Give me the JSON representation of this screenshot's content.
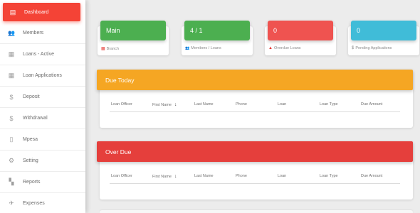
{
  "sidebar": {
    "items": [
      {
        "label": "Dashboard",
        "icon": "dashboard-icon",
        "glyph": "▤",
        "active": true
      },
      {
        "label": "Members",
        "icon": "people-icon",
        "glyph": "👥"
      },
      {
        "label": "Loans - Active",
        "icon": "building-icon",
        "glyph": "▦"
      },
      {
        "label": "Loan Applications",
        "icon": "building-icon",
        "glyph": "▦"
      },
      {
        "label": "Deposit",
        "icon": "dollar-icon",
        "glyph": "$"
      },
      {
        "label": "Withdrawal",
        "icon": "dollar-icon",
        "glyph": "$"
      },
      {
        "label": "Mpesa",
        "icon": "phone-icon",
        "glyph": "▯"
      },
      {
        "label": "Setting",
        "icon": "gear-icon",
        "glyph": "⚙"
      },
      {
        "label": "Reports",
        "icon": "reports-icon",
        "glyph": "▚"
      },
      {
        "label": "Expenses",
        "icon": "airplane-icon",
        "glyph": "✈"
      }
    ]
  },
  "stats": [
    {
      "value": "Main",
      "caption": "Branch",
      "color": "#4caf50",
      "icon": "building-icon",
      "glyph": "▦",
      "icon_color": "#e53935"
    },
    {
      "value": "4 / 1",
      "caption": "Members / Loans",
      "color": "#4caf50",
      "icon": "people-icon",
      "glyph": "👥",
      "icon_color": "#8a8a8a"
    },
    {
      "value": "0",
      "caption": "Overdue Loans",
      "color": "#ef5350",
      "icon": "warning-icon",
      "glyph": "▲",
      "icon_color": "#e53935"
    },
    {
      "value": "0",
      "caption": "Pending Applications",
      "color": "#40bcd8",
      "icon": "dollar-icon",
      "glyph": "$",
      "icon_color": "#8a8a8a"
    }
  ],
  "panels": [
    {
      "title": "Due Today",
      "color": "#f5a623"
    },
    {
      "title": "Over Due",
      "color": "#e53f3c"
    }
  ],
  "table": {
    "columns": [
      "Loan Officer",
      "First Name",
      "Last Name",
      "Phone",
      "Loan",
      "Loan Type",
      "Due Amount"
    ],
    "sort_column": "First Name",
    "sort_icon": "arrow-down-icon"
  }
}
